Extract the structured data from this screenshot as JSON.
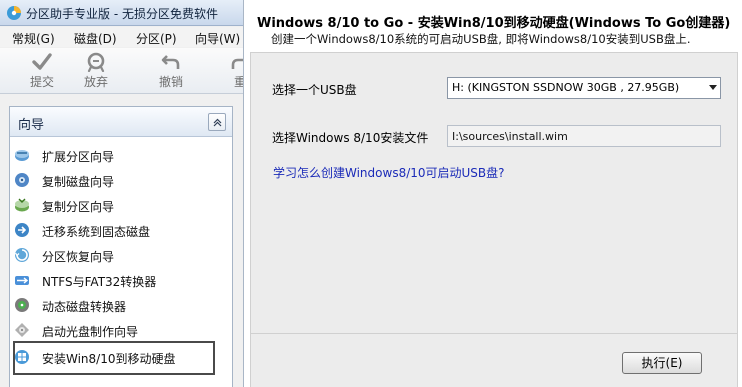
{
  "left_pane": {
    "title": "分区助手专业版 - 无损分区免费软件",
    "menu": [
      "常规(G)",
      "磁盘(D)",
      "分区(P)",
      "向导(W)"
    ],
    "toolbar": [
      {
        "label": "提交",
        "icon": "check-icon"
      },
      {
        "label": "放弃",
        "icon": "discard-icon"
      },
      {
        "label": "撤销",
        "icon": "undo-icon"
      },
      {
        "label": "重",
        "icon": "redo-icon"
      }
    ],
    "wizard": {
      "title": "向导",
      "items": [
        {
          "label": "扩展分区向导",
          "icon": "extend-partition-icon"
        },
        {
          "label": "复制磁盘向导",
          "icon": "copy-disk-icon"
        },
        {
          "label": "复制分区向导",
          "icon": "copy-partition-icon"
        },
        {
          "label": "迁移系统到固态磁盘",
          "icon": "migrate-ssd-icon"
        },
        {
          "label": "分区恢复向导",
          "icon": "partition-recovery-icon"
        },
        {
          "label": "NTFS与FAT32转换器",
          "icon": "ntfs-fat32-converter-icon"
        },
        {
          "label": "动态磁盘转换器",
          "icon": "dynamic-disk-icon"
        },
        {
          "label": "启动光盘制作向导",
          "icon": "bootable-cd-icon"
        },
        {
          "label": "安装Win8/10到移动硬盘",
          "icon": "windows-to-go-icon"
        }
      ],
      "selected_index": 8
    }
  },
  "right_pane": {
    "title": "Windows 8/10 to Go - 安装Win8/10到移动硬盘(Windows To Go创建器)",
    "subtitle": "创建一个Windows8/10系统的可启动USB盘, 即将Windows8/10安装到USB盘上.",
    "usb_label": "选择一个USB盘",
    "usb_selected": "H: (KINGSTON SSDNOW 30GB   , 27.95GB)",
    "file_label": "选择Windows 8/10安装文件",
    "file_value": "I:\\sources\\install.wim",
    "learn_link": "学习怎么创建Windows8/10可启动USB盘?",
    "execute_button": "执行(E)"
  },
  "colors": {
    "link": "#1b2bb8",
    "panel_bg": "#ececec",
    "titlebar_gradient_top": "#e6eef8",
    "titlebar_gradient_bottom": "#c9d8ec"
  }
}
